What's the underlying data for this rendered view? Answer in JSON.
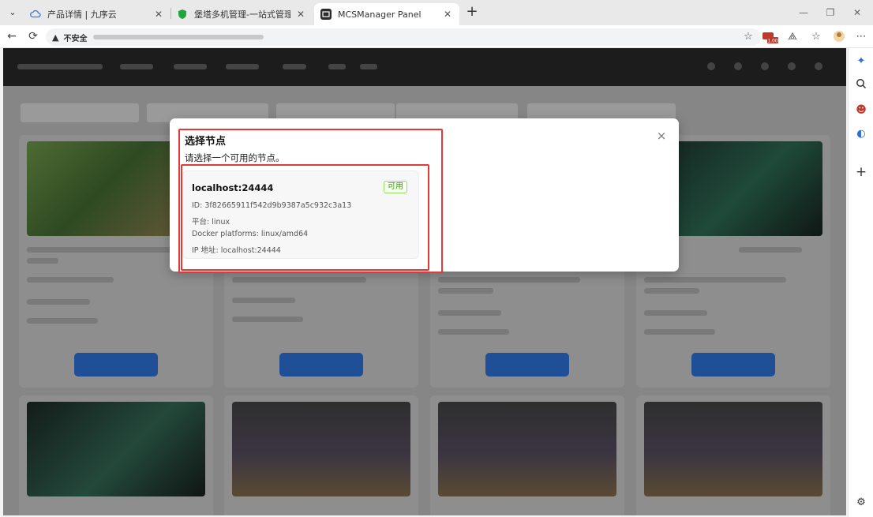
{
  "browser": {
    "tabs": [
      {
        "title": "产品详情 | 九序云",
        "active": false
      },
      {
        "title": "堡塔多机管理-一站式管理宝塔面板",
        "active": false
      },
      {
        "title": "MCSManager Panel",
        "active": true
      }
    ],
    "address": {
      "security_label": "不安全",
      "url": "",
      "badge": "1.00"
    }
  },
  "modal": {
    "title": "选择节点",
    "description": "请选择一个可用的节点。",
    "close_symbol": "×",
    "nodes": [
      {
        "name": "localhost:24444",
        "status": "可用",
        "id_line": "ID: 3f82665911f542d9b9387a5c932c3a13",
        "platform_line": "平台: linux",
        "docker_line": "Docker platforms: linux/amd64",
        "ip_line": "IP 地址: localhost:24444"
      }
    ]
  },
  "colors": {
    "available_badge": "#389e0d",
    "highlight": "#e53935",
    "app_header": "#1c1c1c",
    "primary_button": "#1f4f96"
  },
  "icons": [
    "tab-list-icon",
    "cloud-icon",
    "shield-icon",
    "terminal-icon",
    "back-icon",
    "reload-icon",
    "warning-icon",
    "star-icon",
    "extension-icon",
    "favorites-icon",
    "profile-icon",
    "more-icon",
    "copilot-icon",
    "search-icon",
    "person-icon",
    "outlook-icon",
    "add-icon",
    "settings-icon"
  ]
}
